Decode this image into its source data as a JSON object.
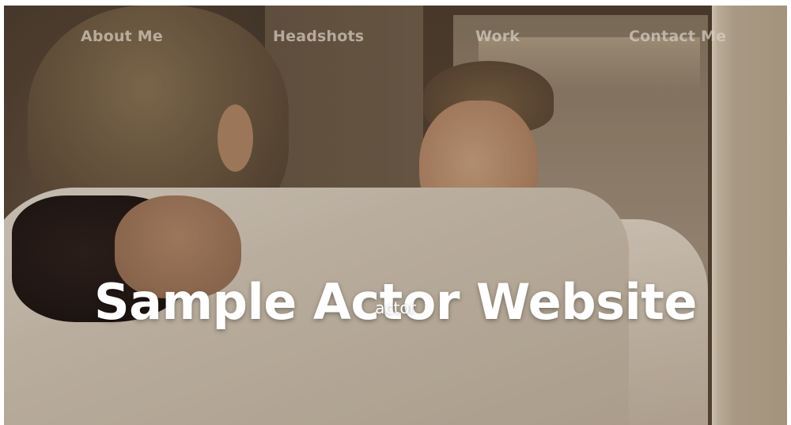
{
  "navigation": {
    "items": [
      {
        "label": "About Me"
      },
      {
        "label": "Headshots"
      },
      {
        "label": "Work"
      },
      {
        "label": "Contact Me"
      }
    ]
  },
  "hero": {
    "title": "Sample Actor Website",
    "subtitle": "actor"
  },
  "colors": {
    "nav_text": "#d7cdc0",
    "title_text": "#ffffff",
    "page_border": "#ffffff"
  }
}
